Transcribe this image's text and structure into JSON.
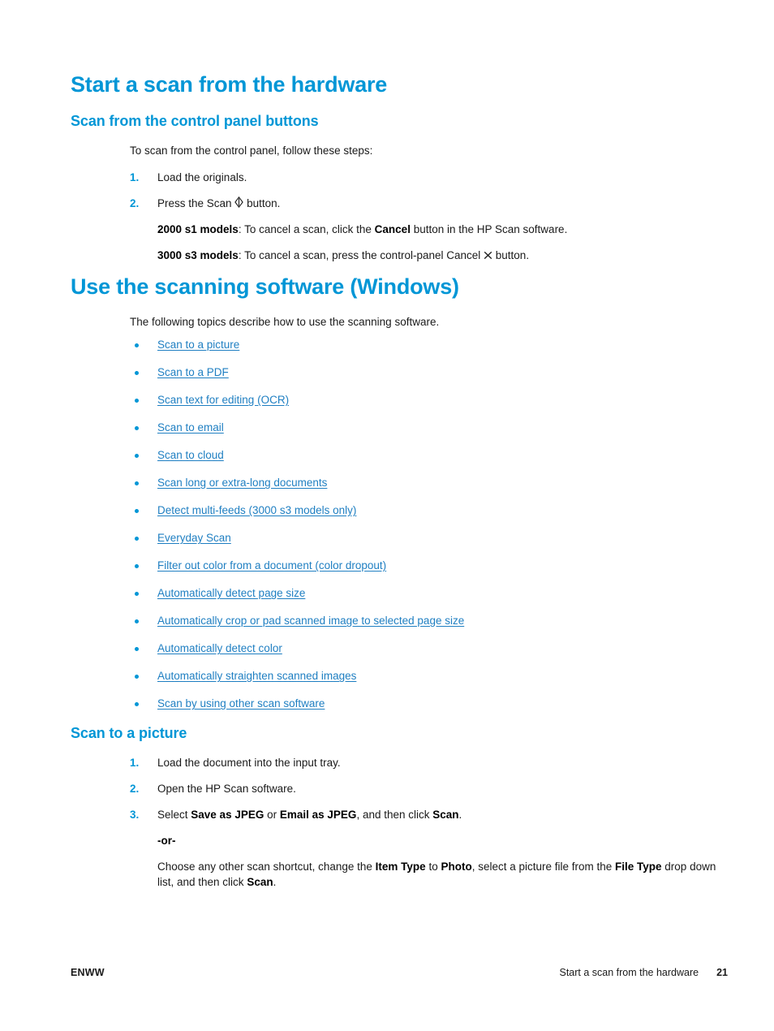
{
  "document": {
    "sections": [
      {
        "h1": "Start a scan from the hardware",
        "h2": "Scan from the control panel buttons",
        "intro": "To scan from the control panel, follow these steps:",
        "steps": [
          {
            "num": "1.",
            "text": "Load the originals."
          },
          {
            "num": "2.",
            "text": "Press the Scan"
          }
        ],
        "step2_suffix": "button.",
        "note_2000_label": "2000 s1 models",
        "note_2000_text_a": ": To cancel a scan, click the ",
        "note_2000_bold": "Cancel",
        "note_2000_text_b": " button in the HP Scan software.",
        "note_3000_label": "3000 s3 models",
        "note_3000_text_a": ": To cancel a scan, press the control-panel Cancel",
        "note_3000_text_b": "button."
      }
    ],
    "software_section": {
      "h1": "Use the scanning software (Windows)",
      "intro": "The following topics describe how to use the scanning software.",
      "links": [
        "Scan to a picture",
        "Scan to a PDF",
        "Scan text for editing (OCR)",
        "Scan to email",
        "Scan to cloud",
        "Scan long or extra-long documents",
        "Detect multi-feeds (3000 s3 models only)",
        "Everyday Scan",
        "Filter out color from a document (color dropout)",
        "Automatically detect page size",
        "Automatically crop or pad scanned image to selected page size",
        "Automatically detect color",
        "Automatically straighten scanned images",
        "Scan by using other scan software"
      ]
    },
    "picture_section": {
      "h2": "Scan to a picture",
      "steps": [
        {
          "num": "1.",
          "text": "Load the document into the input tray."
        },
        {
          "num": "2.",
          "text": "Open the HP Scan software."
        }
      ],
      "step3": {
        "num": "3.",
        "a": "Select ",
        "b1": "Save as JPEG",
        "c": " or ",
        "b2": "Email as JPEG",
        "d": ", and then click ",
        "b3": "Scan",
        "e": "."
      },
      "or_text": "-or-",
      "final": {
        "a": "Choose any other scan shortcut, change the ",
        "b1": "Item Type",
        "c": " to ",
        "b2": "Photo",
        "d": ", select a picture file from the ",
        "b3": "File Type",
        "e": " drop down list, and then click ",
        "b4": "Scan",
        "f": "."
      }
    },
    "footer": {
      "left": "ENWW",
      "title": "Start a scan from the hardware",
      "page_number": "21"
    },
    "icons": {
      "scan_button": "scan-diamond-icon",
      "cancel_button": "cancel-x-icon"
    },
    "colors": {
      "heading_blue": "#0096d6",
      "link_blue": "#1f7fc2",
      "body_text": "#1a1a1a"
    }
  }
}
